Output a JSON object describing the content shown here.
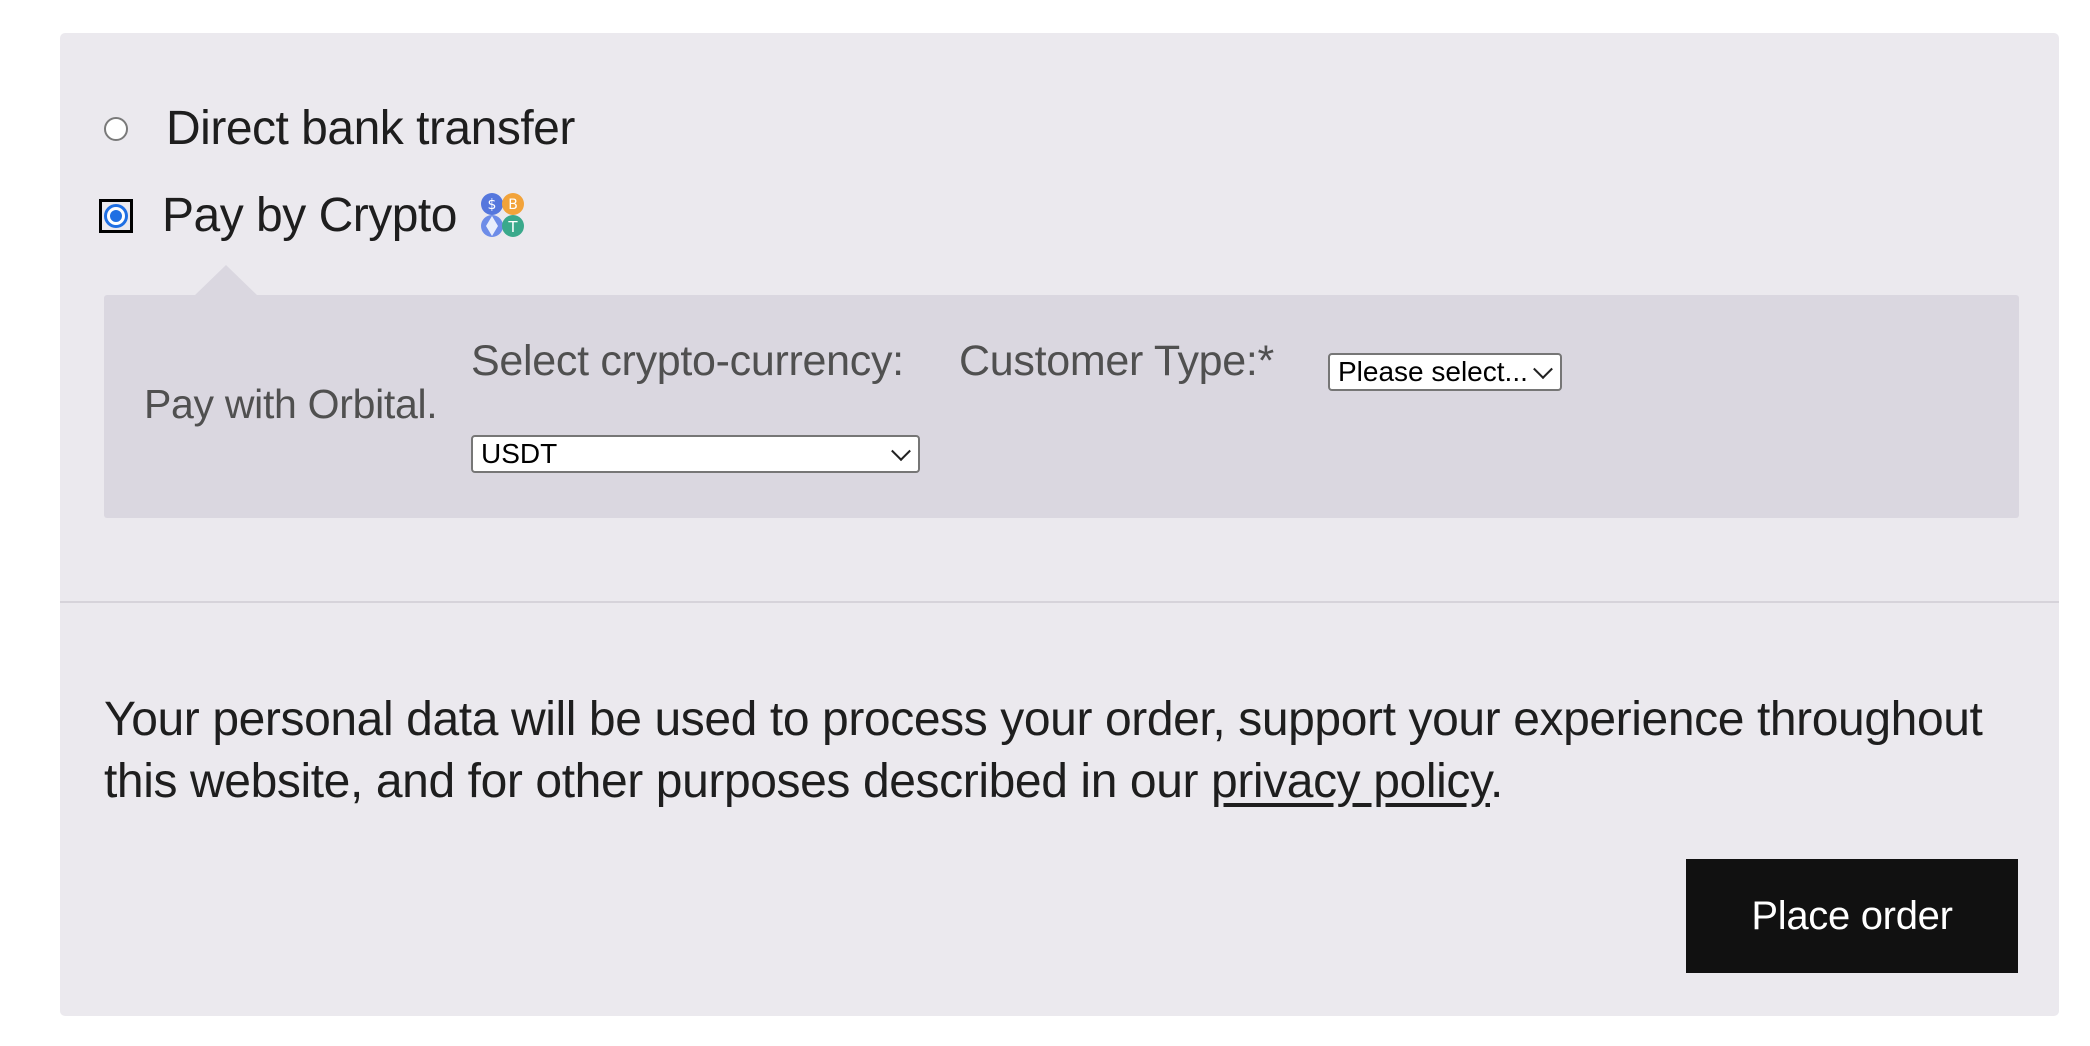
{
  "payment_methods": [
    {
      "label": "Direct bank transfer",
      "selected": false
    },
    {
      "label": "Pay by Crypto",
      "selected": true,
      "icon": "crypto-coins-icon"
    }
  ],
  "crypto_box": {
    "description": "Pay with Orbital.",
    "currency_label": "Select crypto-currency:",
    "currency_value": "USDT",
    "customer_type_label": "Customer Type:*",
    "customer_type_value": "Please select..."
  },
  "privacy": {
    "text_before": "Your personal data will be used to process your order, support your experience throughout this website, and for other purposes described in our ",
    "link_text": "privacy policy",
    "text_after": "."
  },
  "place_order_label": "Place order",
  "colors": {
    "panel_bg": "#ebe9ee",
    "box_bg": "#dad7e0",
    "button_bg": "#111111",
    "radio_selected": "#1f6fe3"
  }
}
